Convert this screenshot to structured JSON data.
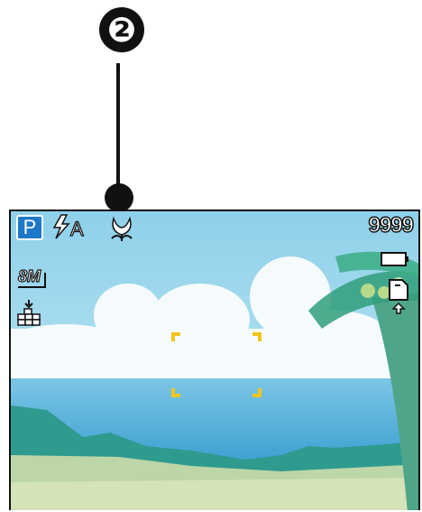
{
  "callout": {
    "number": "❷"
  },
  "osd": {
    "mode": "P",
    "flash": "A",
    "shots_remaining": "9999",
    "resolution": "8M",
    "icons": [
      "flash-auto-icon",
      "macro-icon",
      "battery-icon",
      "resolution-icon",
      "quality-icon",
      "internal-memory-icon",
      "af-frame-icon"
    ]
  },
  "colors": {
    "mode_badge": "#1e78c8",
    "af_bracket": "#f2c51c",
    "sky": "#aee0f0",
    "sea": "#5cb0d8"
  }
}
